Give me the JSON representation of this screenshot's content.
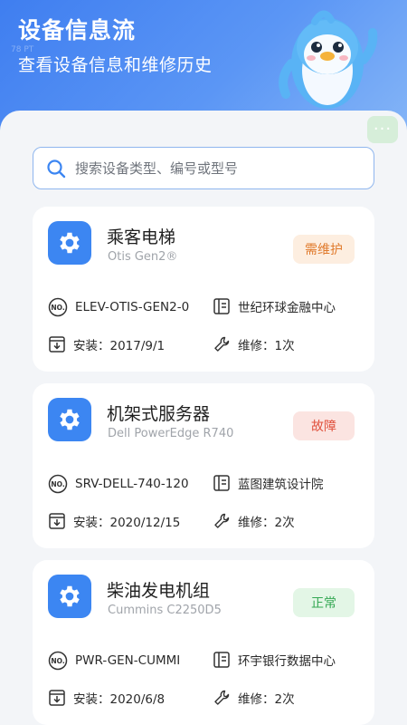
{
  "header": {
    "title": "设备信息流",
    "subtitle": "查看设备信息和维修历史",
    "faint_text": "78 PT"
  },
  "more_button": {
    "label": "···"
  },
  "search": {
    "placeholder": "搜索设备类型、编号或型号"
  },
  "devices": [
    {
      "name": "乘客电梯",
      "model": "Otis Gen2®",
      "status": "需维护",
      "status_type": "warning",
      "code": "ELEV-OTIS-GEN2-0",
      "location": "世纪环球金融中心",
      "install": "安装：2017/9/1",
      "repair": "维修：1次"
    },
    {
      "name": "机架式服务器",
      "model": "Dell PowerEdge R740",
      "status": "故障",
      "status_type": "fault",
      "code": "SRV-DELL-740-120",
      "location": "蓝图建筑设计院",
      "install": "安装：2020/12/15",
      "repair": "维修：2次"
    },
    {
      "name": "柴油发电机组",
      "model": "Cummins C2250D5",
      "status": "正常",
      "status_type": "normal",
      "code": "PWR-GEN-CUMMI",
      "location": "环宇银行数据中心",
      "install": "安装：2020/6/8",
      "repair": "维修：2次"
    }
  ],
  "colors": {
    "primary": "#3c86f2",
    "warning": "#e07a2c",
    "fault": "#e0503c",
    "normal": "#34a853"
  }
}
